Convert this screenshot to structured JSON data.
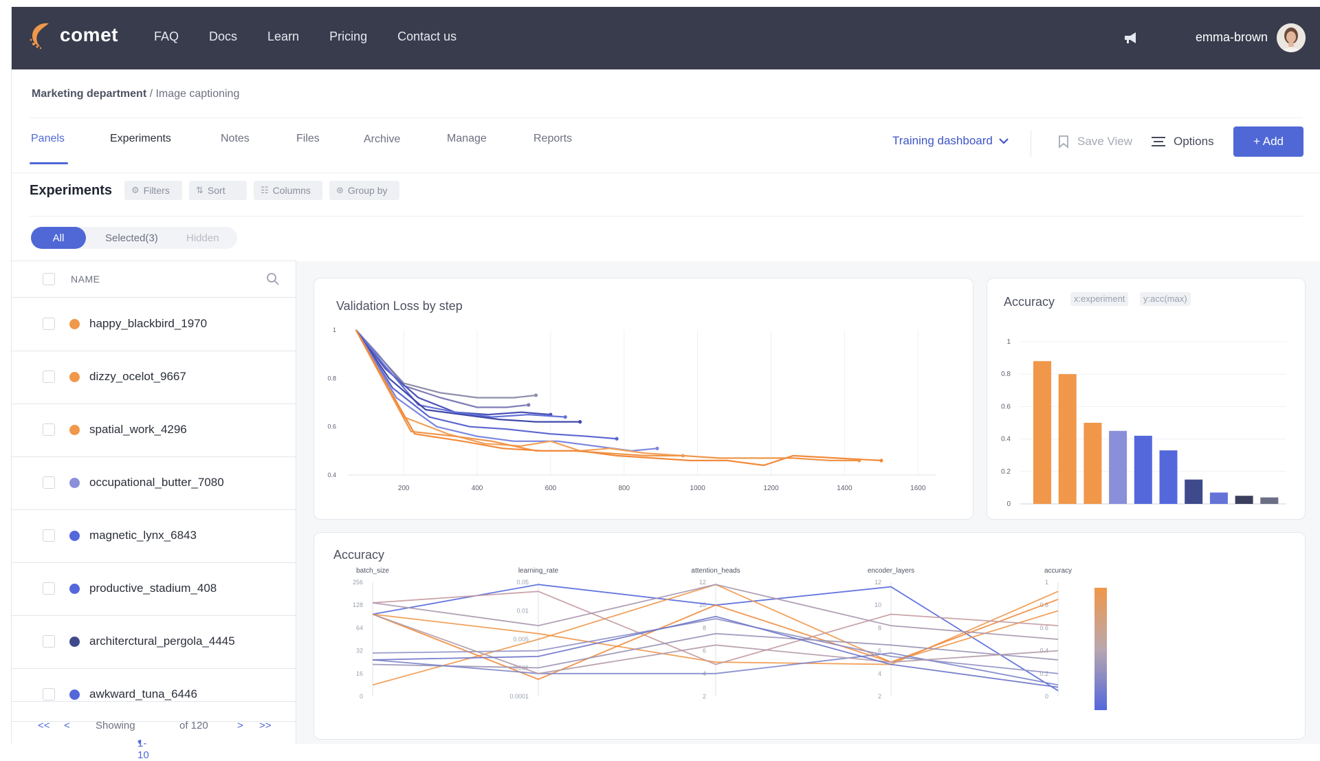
{
  "app": {
    "logo_text": "comet",
    "nav": [
      "FAQ",
      "Docs",
      "Learn",
      "Pricing",
      "Contact us"
    ],
    "username": "emma-brown"
  },
  "breadcrumb": {
    "workspace": "Marketing department",
    "separator": " / ",
    "project": "Image captioning"
  },
  "tabs": [
    "Panels",
    "Experiments",
    "Notes",
    "Files",
    "Archive",
    "Manage",
    "Reports"
  ],
  "active_tab": "Panels",
  "toolbar": {
    "dashboard_select": "Training dashboard",
    "save_view": "Save View",
    "options": "Options",
    "add": "+ Add"
  },
  "experiments": {
    "title": "Experiments",
    "filters": "Filters",
    "sort": "Sort",
    "columns": "Columns",
    "group_by": "Group by",
    "segments": {
      "all": "All",
      "selected": "Selected(3)",
      "hidden": "Hidden"
    },
    "column_header": "NAME",
    "rows": [
      {
        "name": "happy_blackbird_1970",
        "color": "#f0974a"
      },
      {
        "name": "dizzy_ocelot_9667",
        "color": "#f0974a"
      },
      {
        "name": "spatial_work_4296",
        "color": "#f0974a"
      },
      {
        "name": "occupational_butter_7080",
        "color": "#8a8fd9"
      },
      {
        "name": "magnetic_lynx_6843",
        "color": "#5468dc"
      },
      {
        "name": "productive_stadium_408",
        "color": "#5468dc"
      },
      {
        "name": "architerctural_pergola_4445",
        "color": "#3f4a8c"
      },
      {
        "name": "awkward_tuna_6446",
        "color": "#5468dc"
      }
    ],
    "pager": {
      "first": "<<",
      "prev": "<",
      "showing": "Showing",
      "range": "1-10",
      "of": "of 120",
      "next": ">",
      "last": ">>"
    }
  },
  "chart_data": [
    {
      "type": "line",
      "title": "Validation Loss by step",
      "xlabel": "",
      "ylabel": "",
      "xlim": [
        50,
        1650
      ],
      "ylim": [
        0.4,
        1.0
      ],
      "x_ticks": [
        "200",
        "400",
        "600",
        "800",
        "1000",
        "1200",
        "1400",
        "1600"
      ],
      "y_ticks": [
        "0.4",
        "0.6",
        "0.8",
        "1"
      ],
      "series": [
        {
          "color": "#8d8faa",
          "points": [
            [
              70,
              1.0
            ],
            [
              140,
              0.88
            ],
            [
              200,
              0.78
            ],
            [
              300,
              0.74
            ],
            [
              400,
              0.72
            ],
            [
              500,
              0.72
            ],
            [
              560,
              0.73
            ]
          ]
        },
        {
          "color": "#7f7cb5",
          "points": [
            [
              70,
              1.0
            ],
            [
              130,
              0.9
            ],
            [
              200,
              0.77
            ],
            [
              300,
              0.72
            ],
            [
              400,
              0.68
            ],
            [
              480,
              0.68
            ],
            [
              540,
              0.69
            ]
          ]
        },
        {
          "color": "#4a52b5",
          "points": [
            [
              70,
              1.0
            ],
            [
              150,
              0.84
            ],
            [
              240,
              0.72
            ],
            [
              340,
              0.66
            ],
            [
              430,
              0.65
            ],
            [
              520,
              0.66
            ],
            [
              600,
              0.65
            ]
          ]
        },
        {
          "color": "#6373d7",
          "points": [
            [
              70,
              1.0
            ],
            [
              150,
              0.85
            ],
            [
              240,
              0.69
            ],
            [
              340,
              0.66
            ],
            [
              440,
              0.64
            ],
            [
              540,
              0.65
            ],
            [
              640,
              0.64
            ]
          ]
        },
        {
          "color": "#3f48a8",
          "points": [
            [
              70,
              1.0
            ],
            [
              160,
              0.8
            ],
            [
              260,
              0.67
            ],
            [
              360,
              0.65
            ],
            [
              460,
              0.63
            ],
            [
              560,
              0.62
            ],
            [
              680,
              0.62
            ]
          ]
        },
        {
          "color": "#5a66cf",
          "points": [
            [
              70,
              1.0
            ],
            [
              170,
              0.76
            ],
            [
              270,
              0.64
            ],
            [
              380,
              0.6
            ],
            [
              480,
              0.59
            ],
            [
              600,
              0.57
            ],
            [
              700,
              0.56
            ],
            [
              780,
              0.55
            ]
          ]
        },
        {
          "color": "#7b86e0",
          "points": [
            [
              70,
              1.0
            ],
            [
              180,
              0.72
            ],
            [
              290,
              0.6
            ],
            [
              400,
              0.56
            ],
            [
              500,
              0.54
            ],
            [
              620,
              0.54
            ],
            [
              720,
              0.52
            ],
            [
              820,
              0.5
            ],
            [
              890,
              0.51
            ]
          ]
        },
        {
          "color": "#f0a25a",
          "points": [
            [
              70,
              1.0
            ],
            [
              200,
              0.64
            ],
            [
              320,
              0.57
            ],
            [
              420,
              0.53
            ],
            [
              520,
              0.52
            ],
            [
              600,
              0.54
            ],
            [
              680,
              0.5
            ],
            [
              760,
              0.51
            ],
            [
              860,
              0.49
            ],
            [
              960,
              0.48
            ]
          ]
        },
        {
          "color": "#f09549",
          "points": [
            [
              70,
              1.0
            ],
            [
              220,
              0.58
            ],
            [
              340,
              0.56
            ],
            [
              440,
              0.54
            ],
            [
              560,
              0.5
            ],
            [
              660,
              0.5
            ],
            [
              760,
              0.49
            ],
            [
              860,
              0.48
            ],
            [
              960,
              0.48
            ],
            [
              1060,
              0.47
            ],
            [
              1160,
              0.47
            ],
            [
              1260,
              0.47
            ],
            [
              1360,
              0.46
            ],
            [
              1440,
              0.46
            ]
          ]
        },
        {
          "color": "#f28a3a",
          "points": [
            [
              70,
              1.0
            ],
            [
              230,
              0.57
            ],
            [
              360,
              0.54
            ],
            [
              470,
              0.51
            ],
            [
              580,
              0.5
            ],
            [
              680,
              0.5
            ],
            [
              780,
              0.48
            ],
            [
              880,
              0.47
            ],
            [
              980,
              0.46
            ],
            [
              1080,
              0.46
            ],
            [
              1180,
              0.44
            ],
            [
              1260,
              0.48
            ],
            [
              1380,
              0.47
            ],
            [
              1500,
              0.46
            ]
          ]
        }
      ]
    },
    {
      "type": "bar",
      "title": "Accuracy",
      "tags": [
        "x:experiment",
        "y:acc(max)"
      ],
      "ylim": [
        0,
        1
      ],
      "y_ticks": [
        "0",
        "0.2",
        "0.4",
        "0.6",
        "0.8",
        "1"
      ],
      "values": [
        0.88,
        0.8,
        0.5,
        0.45,
        0.42,
        0.33,
        0.15,
        0.07,
        0.05,
        0.04
      ],
      "colors": [
        "#f0974a",
        "#f0974a",
        "#f0974a",
        "#8a8fd9",
        "#5468dc",
        "#5468dc",
        "#3f4a8c",
        "#6373d7",
        "#3b3f5c",
        "#6b6f86"
      ]
    },
    {
      "type": "parallel_coordinates",
      "title": "Accuracy",
      "axes": [
        {
          "name": "batch_size",
          "ticks": [
            "0",
            "16",
            "32",
            "64",
            "128",
            "256"
          ]
        },
        {
          "name": "learning_rate",
          "ticks": [
            "0.0001",
            "0.001",
            "0.005",
            "0.01",
            "0.05"
          ]
        },
        {
          "name": "attention_heads",
          "ticks": [
            "2",
            "4",
            "6",
            "8",
            "10",
            "12"
          ]
        },
        {
          "name": "encoder_layers",
          "ticks": [
            "2",
            "4",
            "6",
            "8",
            "10",
            "12"
          ]
        },
        {
          "name": "accuracy",
          "ticks": [
            "0",
            "0.2",
            "0.4",
            "0.6",
            "0.8",
            "1"
          ]
        }
      ],
      "lines": [
        {
          "color": "#5468dc",
          "values": [
            0.72,
            0.98,
            0.8,
            0.96,
            0.05
          ]
        },
        {
          "color": "#f0974a",
          "values": [
            0.72,
            0.55,
            0.3,
            0.28,
            0.92
          ]
        },
        {
          "color": "#f0974a",
          "values": [
            0.1,
            0.5,
            0.98,
            0.3,
            0.75
          ]
        },
        {
          "color": "#f28a3a",
          "values": [
            0.72,
            0.15,
            0.8,
            0.3,
            0.85
          ]
        },
        {
          "color": "#c49aa0",
          "values": [
            0.82,
            0.92,
            0.28,
            0.72,
            0.62
          ]
        },
        {
          "color": "#a995ad",
          "values": [
            0.82,
            0.62,
            0.98,
            0.62,
            0.5
          ]
        },
        {
          "color": "#8d8fc4",
          "values": [
            0.38,
            0.4,
            0.68,
            0.35,
            0.2
          ]
        },
        {
          "color": "#9a92b4",
          "values": [
            0.28,
            0.25,
            0.55,
            0.45,
            0.32
          ]
        },
        {
          "color": "#7c84c9",
          "values": [
            0.32,
            0.2,
            0.2,
            0.38,
            0.1
          ]
        },
        {
          "color": "#b39aa8",
          "values": [
            0.72,
            0.2,
            0.45,
            0.3,
            0.4
          ]
        },
        {
          "color": "#6b73c8",
          "values": [
            0.32,
            0.35,
            0.7,
            0.28,
            0.08
          ]
        }
      ],
      "colorbar": [
        "#f0974a",
        "#5468dc"
      ]
    }
  ]
}
